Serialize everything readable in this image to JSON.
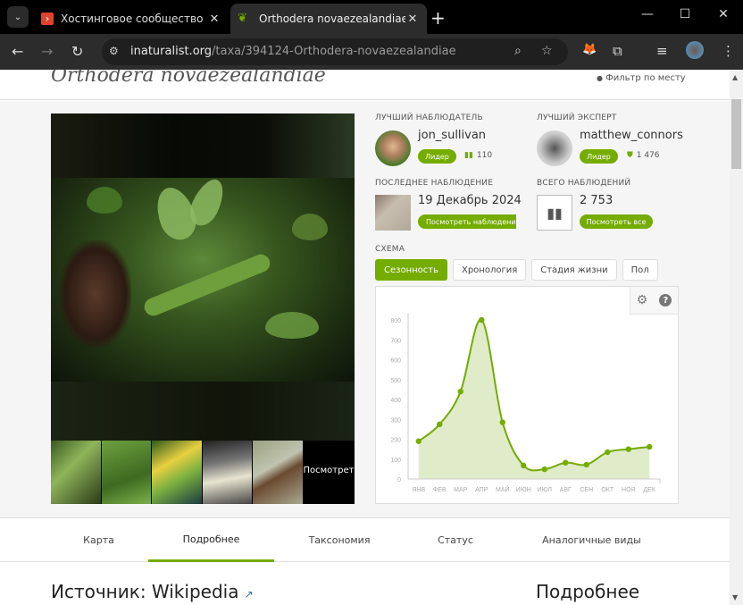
{
  "browser": {
    "tabs": [
      {
        "title": "Хостинговое сообщество «Tim",
        "favicon": "timeweb-icon",
        "active": false
      },
      {
        "title": "Orthodera novaezealandiae · iN",
        "favicon": "inaturalist-icon",
        "active": true
      }
    ],
    "url_domain": "inaturalist.org",
    "url_path": "/taxa/394124-Orthodera-novaezealandiae",
    "icons": {
      "back": "←",
      "forward": "→",
      "reload": "↻",
      "site_info": "⚙",
      "zoom": "⌕",
      "star": "☆",
      "fox": "🦊",
      "extensions": "⧉",
      "media": "≡",
      "menu": "⋮",
      "new_tab": "+",
      "minimize": "—",
      "maximize": "☐",
      "close": "✕",
      "tab_close": "✕",
      "tab_menu": "⌄"
    }
  },
  "page": {
    "taxon_name": "Orthodera novaezealandiae",
    "place_filter": "Фильтр по месту",
    "place_icon": "📍",
    "gallery": {
      "see_more": "Посмотреть все"
    },
    "top_observer": {
      "label": "ЛУЧШИЙ НАБЛЮДАТЕЛЬ",
      "username": "jon_sullivan",
      "badge": "Лидер",
      "count": "110",
      "icon": "binoculars-icon"
    },
    "top_identifier": {
      "label": "ЛУЧШИЙ ЭКСПЕРТ",
      "username": "matthew_connors",
      "badge": "Лидер",
      "count": "1 476",
      "icon": "shield-icon"
    },
    "last_observation": {
      "label": "ПОСЛЕДНЕЕ НАБЛЮДЕНИЕ",
      "date": "19 Декабрь 2024",
      "button": "Посмотреть наблюдение"
    },
    "total_observations": {
      "label": "ВСЕГО НАБЛЮДЕНИЙ",
      "value": "2 753",
      "button": "Посмотреть все"
    },
    "chart_section_label": "СХЕМА",
    "chart_tabs": [
      {
        "label": "Сезонность",
        "active": true
      },
      {
        "label": "Хронология",
        "active": false
      },
      {
        "label": "Стадия жизни",
        "active": false
      },
      {
        "label": "Пол",
        "active": false
      }
    ],
    "chart_tools": {
      "settings": "⚙",
      "help": "?"
    },
    "nav_tabs": [
      {
        "label": "Карта",
        "active": false
      },
      {
        "label": "Подробнее",
        "active": true
      },
      {
        "label": "Таксономия",
        "active": false
      },
      {
        "label": "Статус",
        "active": false
      },
      {
        "label": "Аналогичные виды",
        "active": false
      }
    ],
    "source_title": "Источник: Wikipedia",
    "aside_title": "Подробнее"
  },
  "colors": {
    "accent": "#74ac00",
    "fill": "#dfebc9"
  },
  "chart_data": {
    "type": "area",
    "title": "",
    "xlabel": "",
    "ylabel": "",
    "categories": [
      "ЯНВ",
      "ФЕВ",
      "МАР",
      "АПР",
      "МАЙ",
      "ИЮН",
      "ИЮЛ",
      "АВГ",
      "СЕН",
      "ОКТ",
      "НОЯ",
      "ДЕК"
    ],
    "series": [
      {
        "name": "Сезонность",
        "values": [
          190,
          275,
          440,
          800,
          285,
          68,
          49,
          82,
          72,
          135,
          150,
          162
        ]
      }
    ],
    "yticks": [
      0,
      100,
      200,
      300,
      400,
      500,
      600,
      700,
      800
    ],
    "ylim": [
      0,
      800
    ],
    "grid": false,
    "legend": "none"
  }
}
